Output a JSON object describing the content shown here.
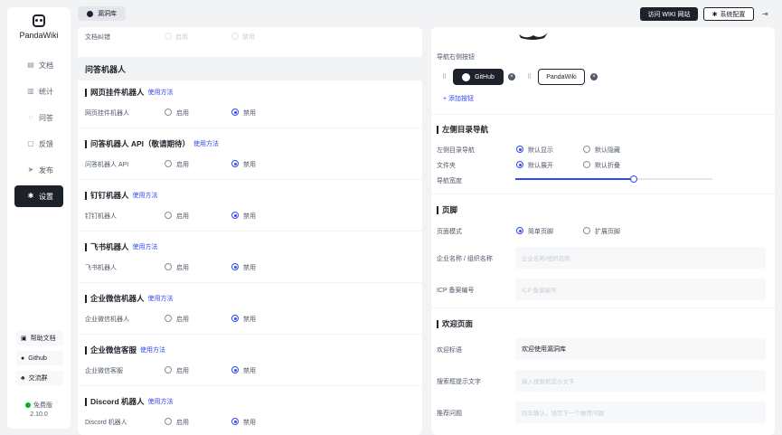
{
  "app": {
    "name": "PandaWiki"
  },
  "sidebar": {
    "items": [
      {
        "label": "文档",
        "icon": "document-icon"
      },
      {
        "label": "统计",
        "icon": "chart-icon"
      },
      {
        "label": "问答",
        "icon": "chat-icon"
      },
      {
        "label": "反馈",
        "icon": "feedback-icon"
      },
      {
        "label": "发布",
        "icon": "send-icon"
      },
      {
        "label": "设置",
        "icon": "gear-icon",
        "active": true
      }
    ],
    "links": [
      {
        "label": "帮助文档",
        "icon": "book-icon"
      },
      {
        "label": "Github",
        "icon": "github-icon"
      },
      {
        "label": "交流群",
        "icon": "group-icon"
      }
    ],
    "plan": "免费版",
    "version": "2.10.0"
  },
  "header": {
    "breadcrumb": "漏洞库",
    "visit_label": "访问 WIKI 网站",
    "config_label": "系统配置"
  },
  "left": {
    "doc_correction": {
      "label": "文档纠错",
      "on": "启用",
      "off": "禁用"
    },
    "section_title": "问答机器人",
    "bots": [
      {
        "title": "网页挂件机器人",
        "link": "使用方法",
        "label": "网页挂件机器人",
        "on": "启用",
        "off": "禁用",
        "selected": "off"
      },
      {
        "title": "问答机器人 API（敬请期待）",
        "link": "使用方法",
        "label": "问答机器人 API",
        "on": "启用",
        "off": "禁用",
        "selected": "off"
      },
      {
        "title": "钉钉机器人",
        "link": "使用方法",
        "label": "钉钉机器人",
        "on": "启用",
        "off": "禁用",
        "selected": "off"
      },
      {
        "title": "飞书机器人",
        "link": "使用方法",
        "label": "飞书机器人",
        "on": "启用",
        "off": "禁用",
        "selected": "off"
      },
      {
        "title": "企业微信机器人",
        "link": "使用方法",
        "label": "企业微信机器人",
        "on": "启用",
        "off": "禁用",
        "selected": "off"
      },
      {
        "title": "企业微信客服",
        "link": "使用方法",
        "label": "企业微信客服",
        "on": "启用",
        "off": "禁用",
        "selected": "off"
      },
      {
        "title": "Discord 机器人",
        "link": "使用方法",
        "label": "Discord 机器人",
        "on": "启用",
        "off": "禁用",
        "selected": "off"
      }
    ]
  },
  "right": {
    "nav_buttons_label": "导航右侧按钮",
    "nav_buttons": [
      {
        "label": "GitHub",
        "icon": "github-icon"
      },
      {
        "label": "PandaWiki"
      }
    ],
    "add_button_label": "+ 添加按钮",
    "catalog": {
      "title": "左侧目录导航",
      "rows": [
        {
          "label": "左侧目录导航",
          "opt1": "默认显示",
          "opt2": "默认隐藏",
          "selected": 1
        },
        {
          "label": "文件夹",
          "opt1": "默认展开",
          "opt2": "默认折叠",
          "selected": 1
        }
      ],
      "width_label": "导航宽度",
      "width_value": 0.6
    },
    "footer": {
      "title": "页脚",
      "mode_label": "页面模式",
      "opt1": "简单页脚",
      "opt2": "扩展页脚",
      "selected": 1,
      "company_label": "企业名称 / 组织名称",
      "company_placeholder": "企业名称/组织名称",
      "icp_label": "ICP 备案编号",
      "icp_placeholder": "ICP 备案编号"
    },
    "welcome": {
      "title": "欢迎页面",
      "welcome_label": "欢迎标语",
      "welcome_value": "欢迎使用漏洞库",
      "search_label": "搜索框提示文字",
      "search_placeholder": "输入搜索框提示文字",
      "recommend_label": "推荐问题",
      "recommend_placeholder": "回车确认，填写下一个推荐问题"
    }
  }
}
